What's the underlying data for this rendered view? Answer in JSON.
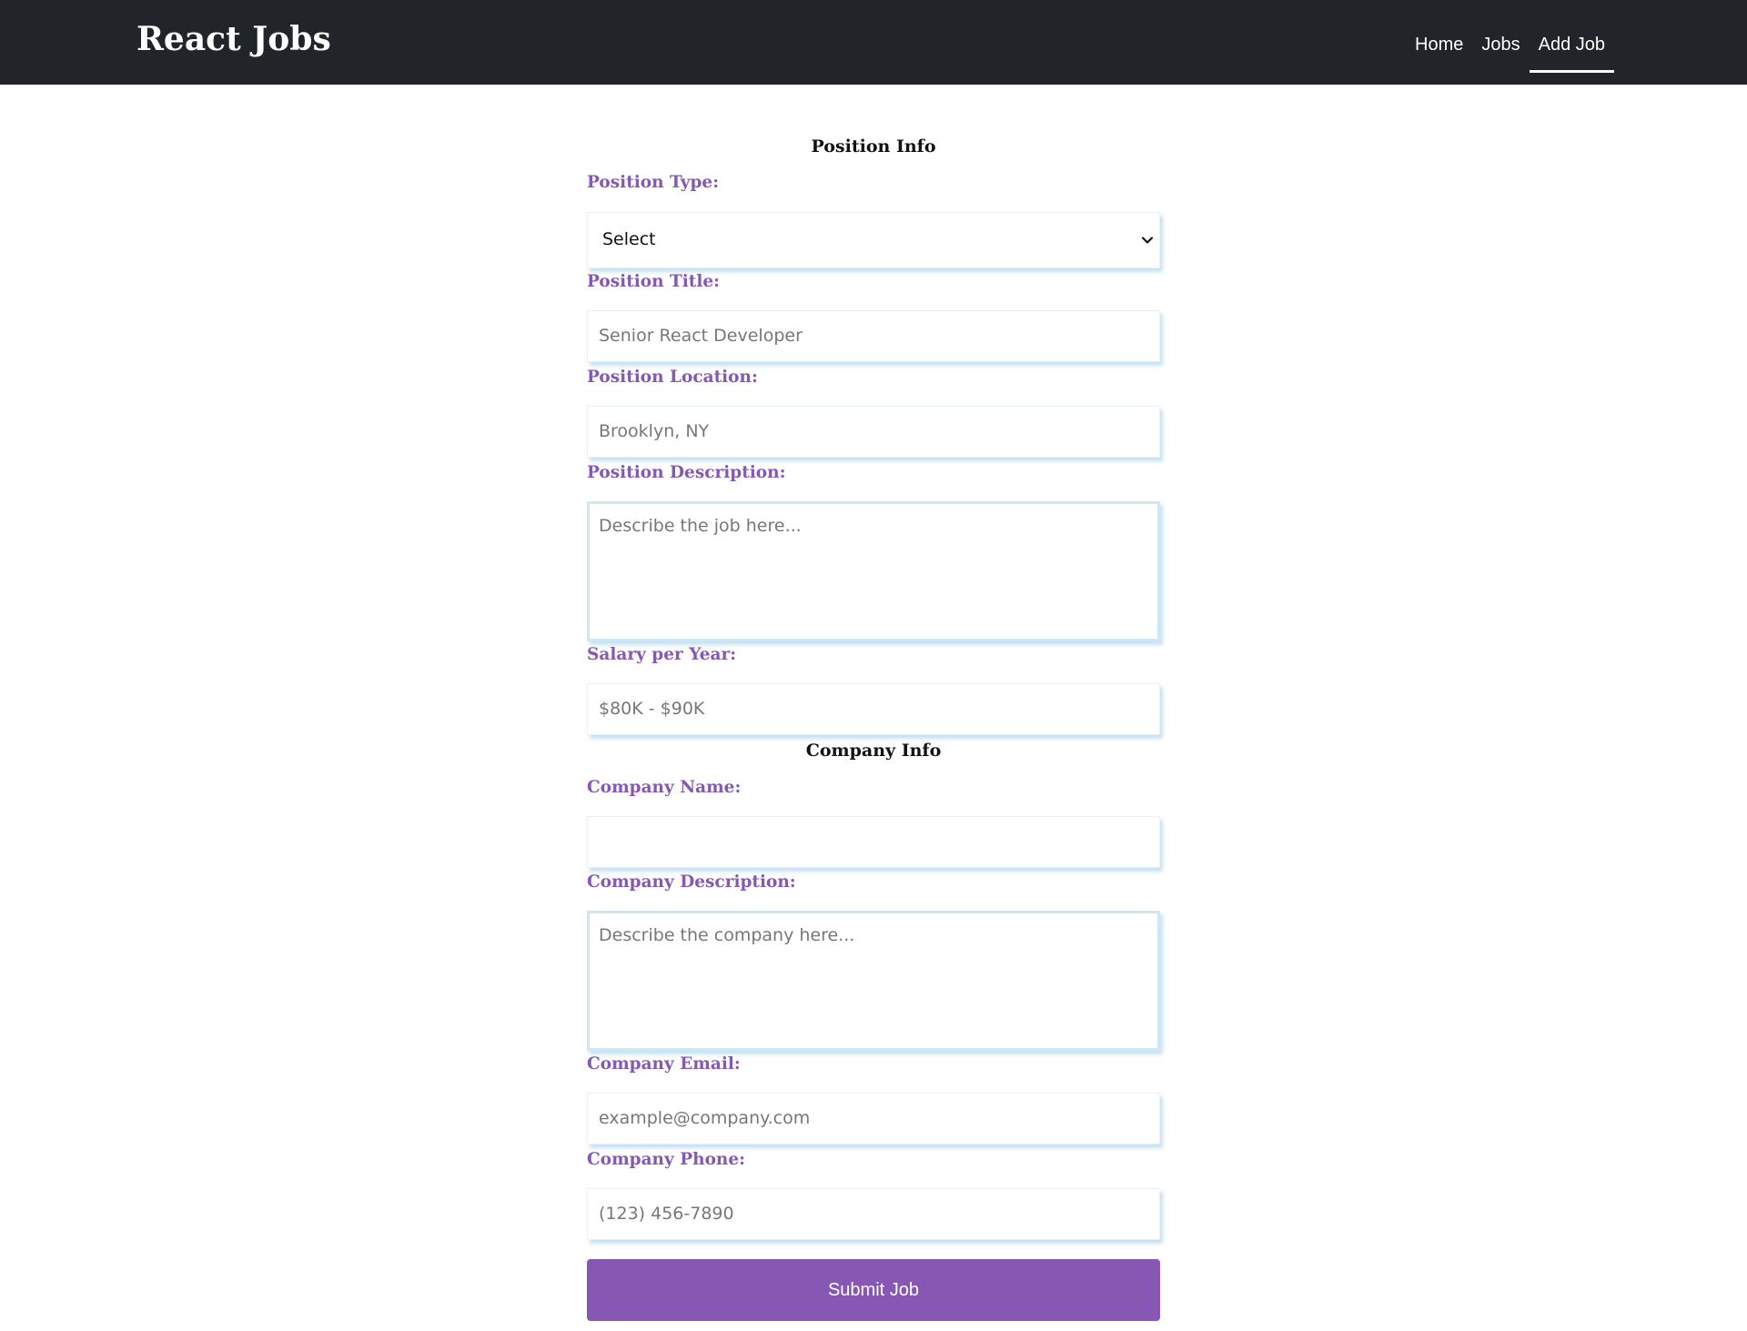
{
  "navbar": {
    "brand": "React Jobs",
    "links": [
      {
        "label": "Home",
        "active": false
      },
      {
        "label": "Jobs",
        "active": false
      },
      {
        "label": "Add Job",
        "active": true
      }
    ]
  },
  "form": {
    "position_section_title": "Position Info",
    "position_type": {
      "label": "Position Type:",
      "value": "Select"
    },
    "position_title": {
      "label": "Position Title:",
      "placeholder": "Senior React Developer"
    },
    "position_location": {
      "label": "Position Location:",
      "placeholder": "Brooklyn, NY"
    },
    "position_description": {
      "label": "Position Description:",
      "placeholder": "Describe the job here..."
    },
    "salary": {
      "label": "Salary per Year:",
      "placeholder": "$80K - $90K"
    },
    "company_section_title": "Company Info",
    "company_name": {
      "label": "Company Name:",
      "placeholder": ""
    },
    "company_description": {
      "label": "Company Description:",
      "placeholder": "Describe the company here..."
    },
    "company_email": {
      "label": "Company Email:",
      "placeholder": "example@company.com"
    },
    "company_phone": {
      "label": "Company Phone:",
      "placeholder": "(123) 456-7890"
    },
    "submit_label": "Submit Job"
  },
  "colors": {
    "navbar_bg": "#212529",
    "label_purple": "#8658b3",
    "button_purple": "#8658b3",
    "field_shadow": "#cfe6f4"
  },
  "icons": {
    "select_arrow": "chevron-down-icon"
  }
}
